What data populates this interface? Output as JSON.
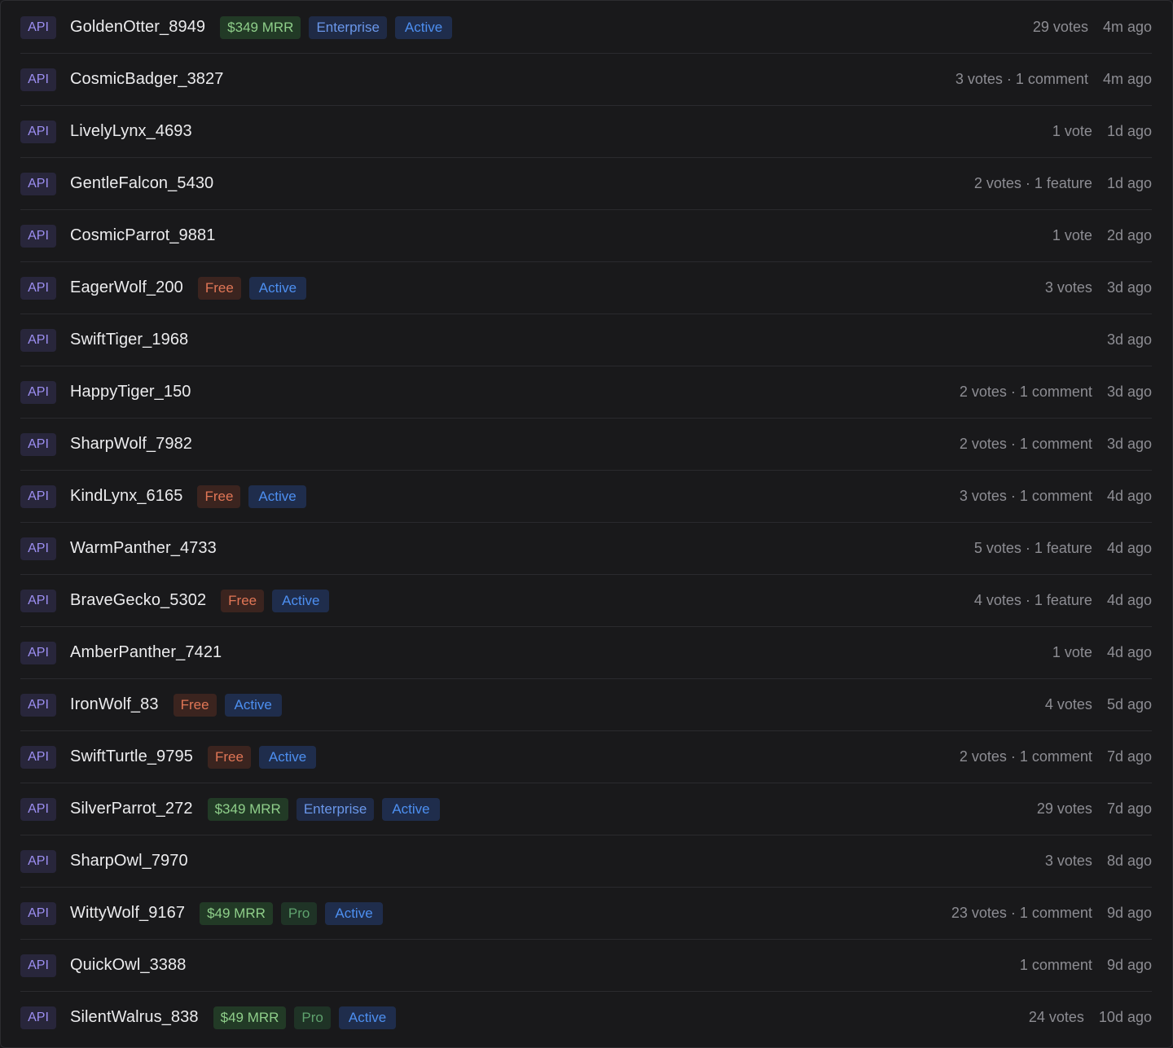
{
  "rows": [
    {
      "badge": "API",
      "name": "GoldenOtter_8949",
      "tags": [
        {
          "kind": "mrr",
          "label": "$349 MRR"
        },
        {
          "kind": "plan-enterprise",
          "label": "Enterprise"
        },
        {
          "kind": "status",
          "label": "Active"
        }
      ],
      "meta": "29 votes",
      "time": "4m ago"
    },
    {
      "badge": "API",
      "name": "CosmicBadger_3827",
      "tags": [],
      "meta": "3 votes · 1 comment",
      "time": "4m ago"
    },
    {
      "badge": "API",
      "name": "LivelyLynx_4693",
      "tags": [],
      "meta": "1 vote",
      "time": "1d ago"
    },
    {
      "badge": "API",
      "name": "GentleFalcon_5430",
      "tags": [],
      "meta": "2 votes · 1 feature",
      "time": "1d ago"
    },
    {
      "badge": "API",
      "name": "CosmicParrot_9881",
      "tags": [],
      "meta": "1 vote",
      "time": "2d ago"
    },
    {
      "badge": "API",
      "name": "EagerWolf_200",
      "tags": [
        {
          "kind": "plan-free",
          "label": "Free"
        },
        {
          "kind": "status",
          "label": "Active"
        }
      ],
      "meta": "3 votes",
      "time": "3d ago"
    },
    {
      "badge": "API",
      "name": "SwiftTiger_1968",
      "tags": [],
      "meta": "",
      "time": "3d ago"
    },
    {
      "badge": "API",
      "name": "HappyTiger_150",
      "tags": [],
      "meta": "2 votes · 1 comment",
      "time": "3d ago"
    },
    {
      "badge": "API",
      "name": "SharpWolf_7982",
      "tags": [],
      "meta": "2 votes · 1 comment",
      "time": "3d ago"
    },
    {
      "badge": "API",
      "name": "KindLynx_6165",
      "tags": [
        {
          "kind": "plan-free",
          "label": "Free"
        },
        {
          "kind": "status",
          "label": "Active"
        }
      ],
      "meta": "3 votes · 1 comment",
      "time": "4d ago"
    },
    {
      "badge": "API",
      "name": "WarmPanther_4733",
      "tags": [],
      "meta": "5 votes · 1 feature",
      "time": "4d ago"
    },
    {
      "badge": "API",
      "name": "BraveGecko_5302",
      "tags": [
        {
          "kind": "plan-free",
          "label": "Free"
        },
        {
          "kind": "status",
          "label": "Active"
        }
      ],
      "meta": "4 votes · 1 feature",
      "time": "4d ago"
    },
    {
      "badge": "API",
      "name": "AmberPanther_7421",
      "tags": [],
      "meta": "1 vote",
      "time": "4d ago"
    },
    {
      "badge": "API",
      "name": "IronWolf_83",
      "tags": [
        {
          "kind": "plan-free",
          "label": "Free"
        },
        {
          "kind": "status",
          "label": "Active"
        }
      ],
      "meta": "4 votes",
      "time": "5d ago"
    },
    {
      "badge": "API",
      "name": "SwiftTurtle_9795",
      "tags": [
        {
          "kind": "plan-free",
          "label": "Free"
        },
        {
          "kind": "status",
          "label": "Active"
        }
      ],
      "meta": "2 votes · 1 comment",
      "time": "7d ago"
    },
    {
      "badge": "API",
      "name": "SilverParrot_272",
      "tags": [
        {
          "kind": "mrr",
          "label": "$349 MRR"
        },
        {
          "kind": "plan-enterprise",
          "label": "Enterprise"
        },
        {
          "kind": "status",
          "label": "Active"
        }
      ],
      "meta": "29 votes",
      "time": "7d ago"
    },
    {
      "badge": "API",
      "name": "SharpOwl_7970",
      "tags": [],
      "meta": "3 votes",
      "time": "8d ago"
    },
    {
      "badge": "API",
      "name": "WittyWolf_9167",
      "tags": [
        {
          "kind": "mrr",
          "label": "$49 MRR"
        },
        {
          "kind": "plan-pro",
          "label": "Pro"
        },
        {
          "kind": "status",
          "label": "Active"
        }
      ],
      "meta": "23 votes · 1 comment",
      "time": "9d ago"
    },
    {
      "badge": "API",
      "name": "QuickOwl_3388",
      "tags": [],
      "meta": "1 comment",
      "time": "9d ago"
    },
    {
      "badge": "API",
      "name": "SilentWalrus_838",
      "tags": [
        {
          "kind": "mrr",
          "label": "$49 MRR"
        },
        {
          "kind": "plan-pro",
          "label": "Pro"
        },
        {
          "kind": "status",
          "label": "Active"
        }
      ],
      "meta": "24 votes",
      "time": "10d ago"
    }
  ]
}
